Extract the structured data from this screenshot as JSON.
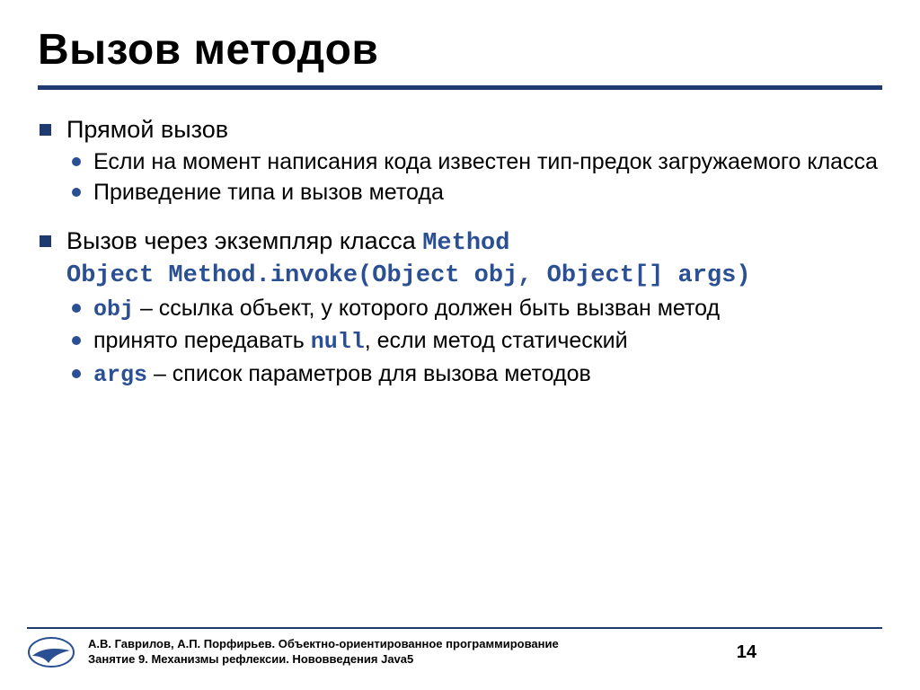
{
  "title": "Вызов методов",
  "b1": {
    "head": "Прямой вызов",
    "s1": "Если на момент написания кода известен тип-предок загружаемого класса",
    "s2": "Приведение типа и вызов метода"
  },
  "b2": {
    "head_pre": "Вызов через экземпляр класса ",
    "head_code": "Method",
    "code_line": "Object Method.invoke(Object obj, Object[] args)",
    "s1_code": "obj",
    "s1_rest": " – ссылка объект, у которого должен быть вызван метод",
    "s2_pre": "принято передавать ",
    "s2_code": "null",
    "s2_rest": ", если метод статический",
    "s3_code": "args",
    "s3_rest": " – список параметров для вызова методов"
  },
  "footer": {
    "line1": "А.В. Гаврилов, А.П. Порфирьев. Объектно-ориентированное программирование",
    "line2": "Занятие 9. Механизмы рефлексии. Нововведения Java5",
    "page": "14"
  }
}
